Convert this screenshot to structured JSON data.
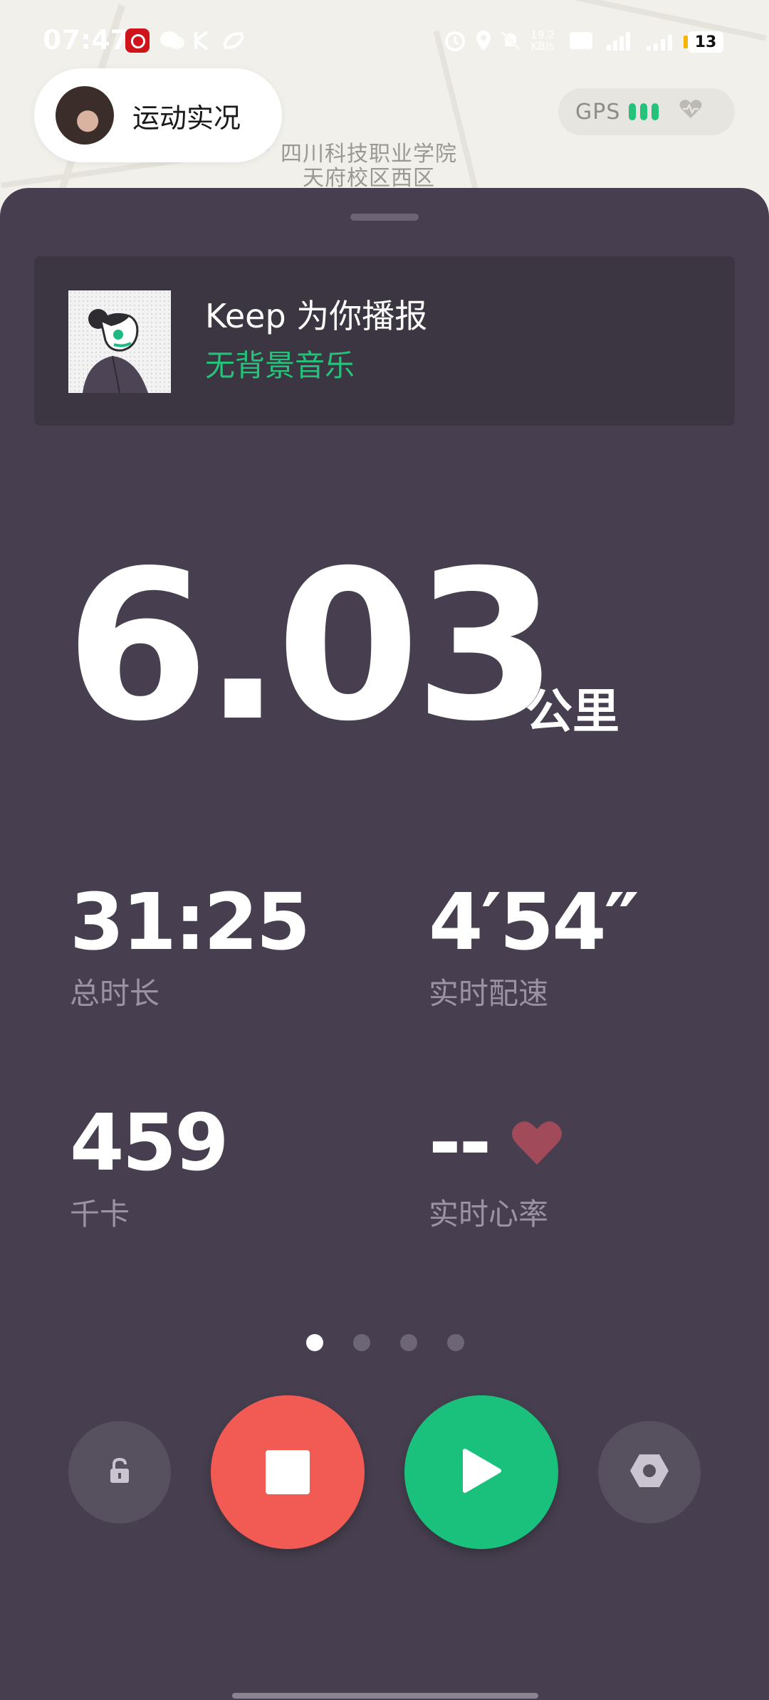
{
  "status_bar": {
    "time": "07:47",
    "network_speed": "19.2 KB/s",
    "signal_label": "5G",
    "battery_level": "13"
  },
  "header": {
    "live_label": "运动实况",
    "gps_label": "GPS",
    "map_label_line1": "四川科技职业学院",
    "map_label_line2": "天府校区西区"
  },
  "audio": {
    "title": "Keep 为你播报",
    "subtitle": "无背景音乐"
  },
  "distance": {
    "value": "6.03",
    "unit": "公里"
  },
  "stats": {
    "duration": {
      "value": "31:25",
      "label": "总时长"
    },
    "pace": {
      "value": "4′54″",
      "label": "实时配速"
    },
    "calories": {
      "value": "459",
      "label": "千卡"
    },
    "heart_rate": {
      "value": "--",
      "label": "实时心率"
    }
  },
  "pager": {
    "pages": 4,
    "active": 1
  },
  "colors": {
    "panel": "#473f4f",
    "accent_green": "#19c17d",
    "stop_red": "#f25a54",
    "heart": "#a04a5a"
  },
  "icons": {
    "lock": "lock-icon",
    "stop": "stop-icon",
    "play": "play-icon",
    "settings": "settings-icon",
    "heart": "heart-icon"
  }
}
